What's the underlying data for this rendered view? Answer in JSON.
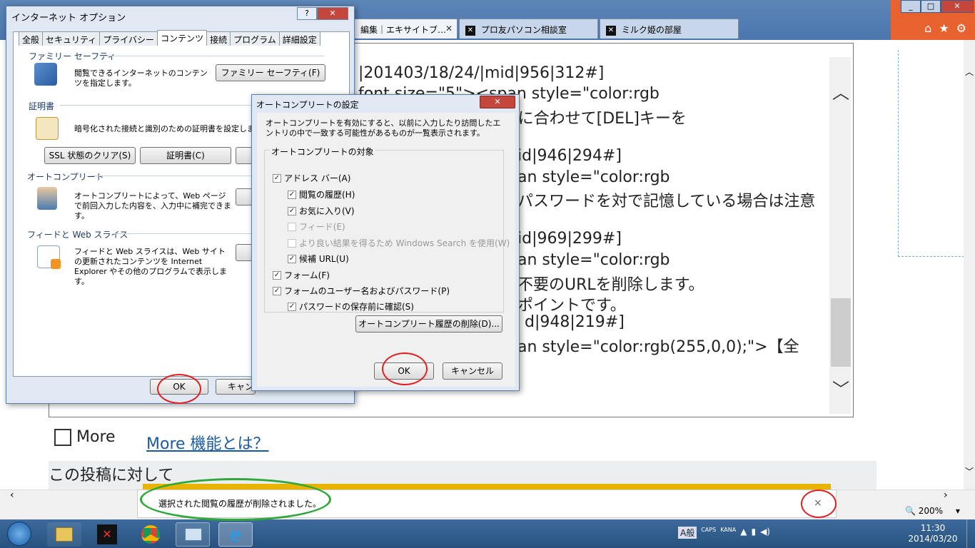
{
  "browser": {
    "tabs": [
      {
        "label": "編集｜エキサイトブ…",
        "active": true
      },
      {
        "label": "プロ友パソコン相談室",
        "active": false
      },
      {
        "label": "ミルク姫の部屋",
        "active": false
      }
    ],
    "window_buttons": {
      "min": "_",
      "max": "□",
      "close": "✕"
    },
    "toolbar_icons": [
      "home-icon",
      "star-icon",
      "gear-icon"
    ],
    "zoom": "200%"
  },
  "content": {
    "lines": [
      "|201403/18/24/|mid|956|312#]",
      "font size=\"5\"><span style=\"color:rgb",
      "を削除するURLに合わせて[DEL]キーを",
      "id|946|294#]",
      "an style=\"color:rgb",
      "パスワードを対で記憶している場合は注意",
      "id|969|299#]",
      "an style=\"color:rgb",
      "不要のURLを削除します。",
      "ポイントです。",
      "d|948|219#]",
      "an style=\"color:rgb(255,0,0);\">【全"
    ],
    "more_label": "More",
    "more_link": "More 機能とは？",
    "post_title": "この投稿に対して"
  },
  "notification": {
    "text": "選択された閲覧の履歴が削除されました。",
    "close": "×"
  },
  "dialog_internet_options": {
    "title": "インターネット オプション",
    "help": "?",
    "close": "✕",
    "tabs": [
      "全般",
      "セキュリティ",
      "プライバシー",
      "コンテンツ",
      "接続",
      "プログラム",
      "詳細設定"
    ],
    "family_safety": {
      "heading": "ファミリー セーフティ",
      "text": "閲覧できるインターネットのコンテンツを指定します。",
      "button": "ファミリー セーフティ(F)"
    },
    "certificates": {
      "heading": "証明書",
      "text": "暗号化された接続と識別のための証明書を設定しま",
      "button_ssl": "SSL 状態のクリア(S)",
      "button_cert": "証明書(C)"
    },
    "autocomplete": {
      "heading": "オートコンプリート",
      "text": "オートコンプリートによって、Web ページで前回入力した内容を、入力中に補完できます。"
    },
    "feeds": {
      "heading": "フィードと Web スライス",
      "text": "フィードと Web スライスは、Web サイトの更新されたコンテンツを Internet Explorer やその他のプログラムで表示します。"
    },
    "ok": "OK",
    "cancel": "キャン"
  },
  "dialog_autocomplete": {
    "title": "オートコンプリートの設定",
    "description": "オートコンプリートを有効にすると、以前に入力したり訪問したエントリの中で一致する可能性があるものが一覧表示されます。",
    "group_label": "オートコンプリートの対象",
    "options": [
      {
        "label": "アドレス バー(A)",
        "checked": true,
        "disabled": false,
        "indent": 0
      },
      {
        "label": "閲覧の履歴(H)",
        "checked": true,
        "disabled": false,
        "indent": 1
      },
      {
        "label": "お気に入り(V)",
        "checked": true,
        "disabled": false,
        "indent": 1
      },
      {
        "label": "フィード(E)",
        "checked": false,
        "disabled": true,
        "indent": 1
      },
      {
        "label": "より良い結果を得るため Windows Search を使用(W)",
        "checked": false,
        "disabled": true,
        "indent": 1
      },
      {
        "label": "候補 URL(U)",
        "checked": true,
        "disabled": false,
        "indent": 1
      },
      {
        "label": "フォーム(F)",
        "checked": true,
        "disabled": false,
        "indent": 0
      },
      {
        "label": "フォームのユーザー名およびパスワード(P)",
        "checked": true,
        "disabled": false,
        "indent": 0
      },
      {
        "label": "パスワードの保存前に確認(S)",
        "checked": true,
        "disabled": false,
        "indent": 1
      }
    ],
    "delete_button": "オートコンプリート履歴の削除(D)...",
    "ok": "OK",
    "cancel": "キャンセル",
    "close": "✕"
  },
  "taskbar": {
    "time": "11:30",
    "date": "2014/03/20",
    "ime": "A般",
    "caps": "CAPS",
    "kana": "KANA"
  }
}
